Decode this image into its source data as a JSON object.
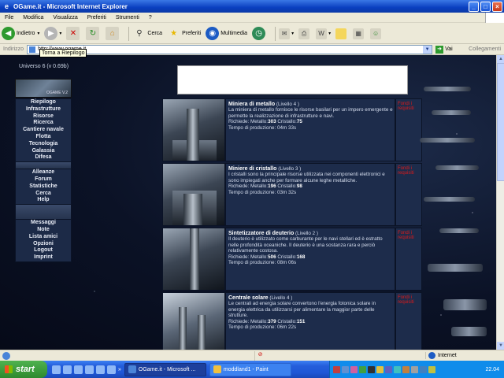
{
  "window": {
    "title": "OGame.it - Microsoft Internet Explorer"
  },
  "menubar": [
    "File",
    "Modifica",
    "Visualizza",
    "Preferiti",
    "Strumenti",
    "?"
  ],
  "toolbar": {
    "back_label": "Indietro",
    "search_label": "Cerca",
    "favorites_label": "Preferiti",
    "media_label": "Multimedia"
  },
  "addressbar": {
    "label": "Indirizzo",
    "url": "http://www.ogame.it",
    "go_label": "Vai",
    "links_label": "Collegamenti"
  },
  "tooltip": "Torna a Riepilogo",
  "page": {
    "universe": "Universo 6 (v 0.69b)",
    "logo_text": "OGAME V.2",
    "menu_group1": [
      "Riepilogo",
      "Infrastrutture",
      "Risorse",
      "Ricerca",
      "Cantiere navale",
      "Flotta",
      "Tecnologia",
      "Galassia",
      "Difesa"
    ],
    "menu_group2": [
      "Alleanze",
      "Forum",
      "Statistiche",
      "Cerca",
      "Help"
    ],
    "menu_group3": [
      "Messaggi",
      "Note",
      "Lista amici",
      "Opzioni",
      "Logout",
      "Imprint"
    ],
    "buildings": [
      {
        "name": "Miniera di metallo",
        "level": "(Livello 4 )",
        "description": "La miniera di metallo fornisce le risorse basilari per un impero emergente e permette la realizzazione di infrastrutture e navi.",
        "req_prefix": "Richiede: Metallo:",
        "metal": "303",
        "crystal_prefix": "Cristallo:",
        "crystal": "75",
        "time": "Tempo di produzione: 04m 33s",
        "action": "Fondi i requisiti"
      },
      {
        "name": "Miniere di cristallo",
        "level": "(Livello 3 )",
        "description": "I cristalli sono la principale risorse utilizzata nei componenti elettronici e sono impiegati anche per formare alcune leghe metalliche.",
        "req_prefix": "Richiede: Metallo:",
        "metal": "196",
        "crystal_prefix": "Cristallo:",
        "crystal": "98",
        "time": "Tempo di produzione: 03m 32s",
        "action": "Fondi i requisiti"
      },
      {
        "name": "Sintetizzatore di deuterio",
        "level": "(Livello 2 )",
        "description": "Il deuterio è utilizzato come carburante per le navi stellari ed è estratto nelle profondità oceaniche. Il deuterio è una sostanza rara e perciò relativamente costosa.",
        "req_prefix": "Richiede: Metallo:",
        "metal": "506",
        "crystal_prefix": "Cristallo:",
        "crystal": "168",
        "time": "Tempo di produzione: 08m 06s",
        "action": "Fondi i requisiti"
      },
      {
        "name": "Centrale solare",
        "level": "(Livello 4 )",
        "description": "Le centrali ad energia solare convertono l'energia fotonica solare in energia elettrica da utilizzarsi per alimentare la maggior parte delle strutture.",
        "req_prefix": "Richiede: Metallo:",
        "metal": "379",
        "crystal_prefix": "Cristallo:",
        "crystal": "151",
        "time": "Tempo di produzione: 06m 22s",
        "action": "Fondi i requisiti"
      }
    ]
  },
  "statusbar": {
    "zone": "Internet"
  },
  "taskbar": {
    "start_label": "start",
    "tasks": [
      "OGame.it - Microsoft ...",
      "moddland1 - Paint"
    ],
    "clock": "22.04"
  },
  "colors": {
    "titlebar": "#0a3fc0",
    "page_bg": "#0b1226",
    "menu_bg": "#1c2a47",
    "row_bg": "#1d2c4b",
    "action_text": "#e01a1a",
    "taskbar": "#245edb",
    "start_green": "#2e8a2e"
  }
}
